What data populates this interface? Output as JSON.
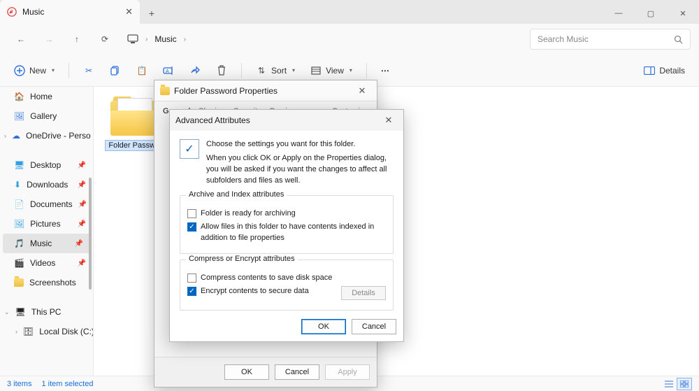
{
  "tab": {
    "title": "Music"
  },
  "newtab_glyph": "+",
  "win": {
    "min": "—",
    "max": "▢",
    "close": "✕"
  },
  "nav": {
    "back": "←",
    "fwd": "→",
    "up": "↑",
    "refresh": "⟳",
    "root_glyph": "🖥",
    "sep": "›",
    "current": "Music"
  },
  "search": {
    "placeholder": "Search Music",
    "glass": "🔍"
  },
  "toolbar": {
    "new": "New",
    "sort": "Sort",
    "view": "View",
    "more": "⋯",
    "details": "Details"
  },
  "sidebar": {
    "home": "Home",
    "gallery": "Gallery",
    "onedrive": "OneDrive - Perso",
    "desktop": "Desktop",
    "downloads": "Downloads",
    "documents": "Documents",
    "pictures": "Pictures",
    "music": "Music",
    "videos": "Videos",
    "screenshots": "Screenshots",
    "thispc": "This PC",
    "cdrive": "Local Disk (C:)"
  },
  "content": {
    "folder_name": "Folder Passw..."
  },
  "status": {
    "items": "3 items",
    "selected": "1 item selected"
  },
  "props": {
    "title": "Folder Password Properties",
    "tabs": [
      "General",
      "Sharing",
      "Security",
      "Previous Versions",
      "Customize"
    ],
    "ok": "OK",
    "cancel": "Cancel",
    "apply": "Apply"
  },
  "adv": {
    "title": "Advanced Attributes",
    "head1": "Choose the settings you want for this folder.",
    "head2": "When you click OK or Apply on the Properties dialog, you will be asked if you want the changes to affect all subfolders and files as well.",
    "group1": "Archive and Index attributes",
    "c1": "Folder is ready for archiving",
    "c2": "Allow files in this folder to have contents indexed in addition to file properties",
    "group2": "Compress or Encrypt attributes",
    "c3": "Compress contents to save disk space",
    "c4": "Encrypt contents to secure data",
    "details": "Details",
    "ok": "OK",
    "cancel": "Cancel"
  }
}
